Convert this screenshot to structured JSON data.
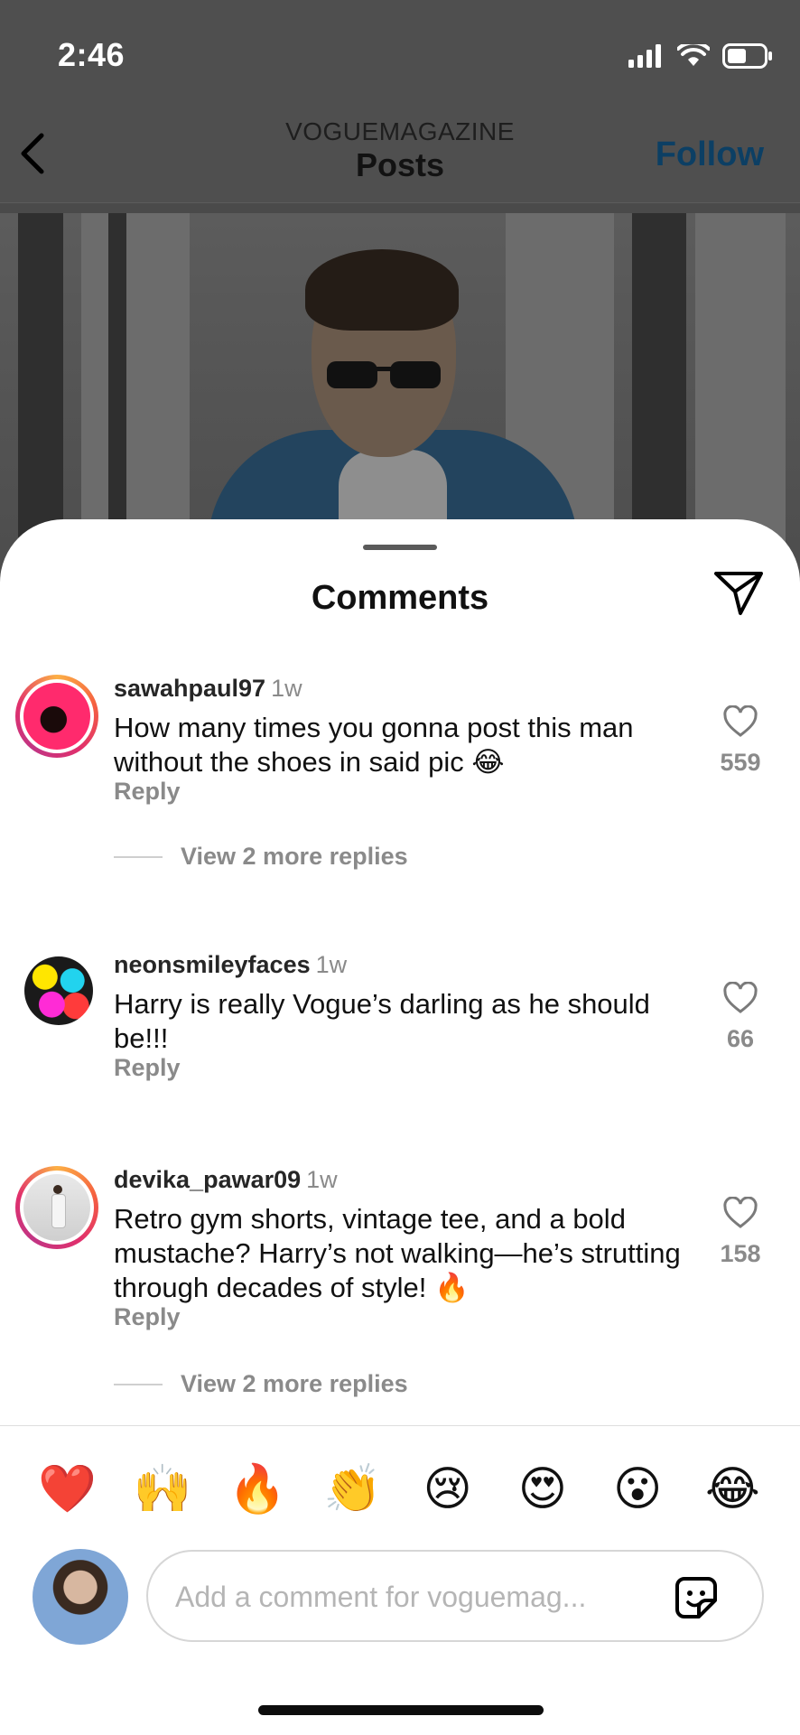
{
  "status": {
    "time": "2:46"
  },
  "header": {
    "account": "VOGUEMAGAZINE",
    "title": "Posts",
    "follow_label": "Follow"
  },
  "sheet": {
    "title": "Comments"
  },
  "comments": [
    {
      "user": "sawahpaul97",
      "ago": "1w",
      "text": "How many times you gonna post this man without the shoes in said pic 😂",
      "reply_label": "Reply",
      "likes": "559",
      "more_replies": "View 2 more replies"
    },
    {
      "user": "neonsmileyfaces",
      "ago": "1w",
      "text": "Harry is really Vogue’s darling as he should be!!!",
      "reply_label": "Reply",
      "likes": "66"
    },
    {
      "user": "devika_pawar09",
      "ago": "1w",
      "text": "Retro gym shorts, vintage tee, and a bold mustache? Harry’s not walking—he’s strutting through decades of style! 🔥",
      "reply_label": "Reply",
      "likes": "158",
      "more_replies": "View 2 more replies"
    }
  ],
  "quick_reactions": [
    "❤️",
    "🙌",
    "🔥",
    "👏",
    "😢",
    "😍",
    "😮",
    "😂"
  ],
  "composer": {
    "placeholder": "Add a comment for voguemag..."
  },
  "icons": {
    "back": "chevron-left-icon",
    "send": "paper-plane-icon",
    "like": "heart-outline-icon",
    "sticker": "sticker-icon"
  },
  "colors": {
    "follow": "#0c3f64",
    "muted": "#8a8a8a"
  }
}
